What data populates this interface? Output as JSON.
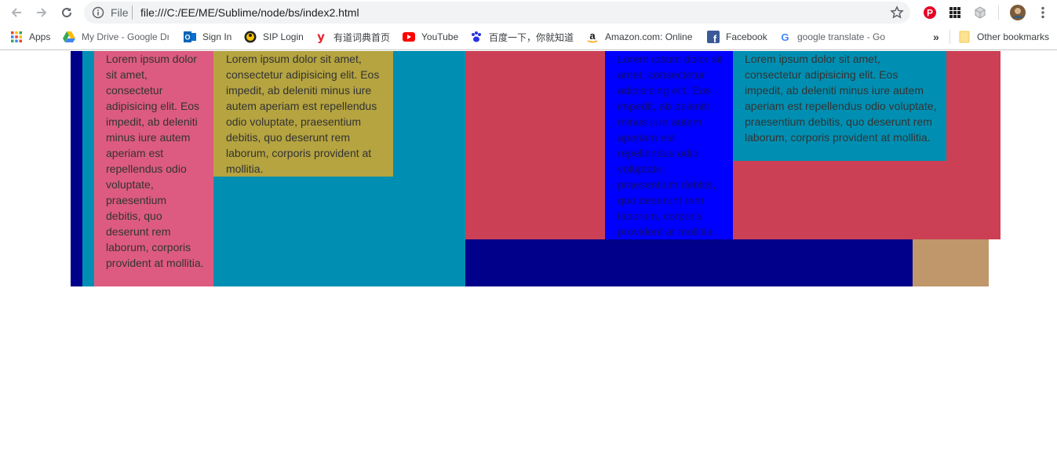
{
  "browser": {
    "url_scheme": "File",
    "url": "file:///C:/EE/ME/Sublime/node/bs/index2.html"
  },
  "bookmarks": [
    {
      "label": "Apps",
      "icon": "apps-grid-icon"
    },
    {
      "label": "My Drive - Google Dr",
      "icon": "google-drive-icon"
    },
    {
      "label": "Sign In",
      "icon": "outlook-icon"
    },
    {
      "label": "SIP Login",
      "icon": "sip-icon"
    },
    {
      "label": "有道词典首页",
      "icon": "youdao-icon"
    },
    {
      "label": "YouTube",
      "icon": "youtube-icon"
    },
    {
      "label": "百度一下，你就知道",
      "icon": "baidu-paw-icon"
    },
    {
      "label": "Amazon.com: Online",
      "icon": "amazon-icon"
    },
    {
      "label": "Facebook",
      "icon": "facebook-icon"
    },
    {
      "label": "google translate - Go",
      "icon": "google-icon"
    }
  ],
  "overflow_label": "»",
  "other_bookmarks": "Other bookmarks",
  "content": {
    "col1_text": "Lorem ipsum dolor sit amet, consectetur adipisicing elit. Eos impedit, ab deleniti minus iure autem aperiam est repellendus odio voluptate, praesentium debitis, quo deserunt rem laborum, corporis provident at mollitia.",
    "col2_text": "Lorem ipsum dolor sit amet, consectetur adipisicing elit. Eos impedit, ab deleniti minus iure autem aperiam est repellendus odio voluptate, praesentium debitis, quo deserunt rem laborum, corporis provident at mollitia.",
    "col3_text": "Lorem ipsum dolor sit amet, consectetur adipisicing elit. Eos impedit, ab deleniti minus iure autem aperiam est repellendus odio voluptate, praesentium debitis, quo deserunt rem laborum, corporis provident at mollitia.",
    "col4_text": "Lorem ipsum dolor sit amet, consectetur adipisicing elit. Eos impedit, ab deleniti minus iure autem aperiam est repellendus odio voluptate, praesentium debitis, quo deserunt rem laborum, corporis provident at mollitia."
  },
  "colors": {
    "navy": "#00008b",
    "teal": "#008fb2",
    "pink": "#dd5b80",
    "olive": "#b5a440",
    "crimson": "#cb4055",
    "blue": "#0000ff",
    "tan": "#c0976a"
  }
}
